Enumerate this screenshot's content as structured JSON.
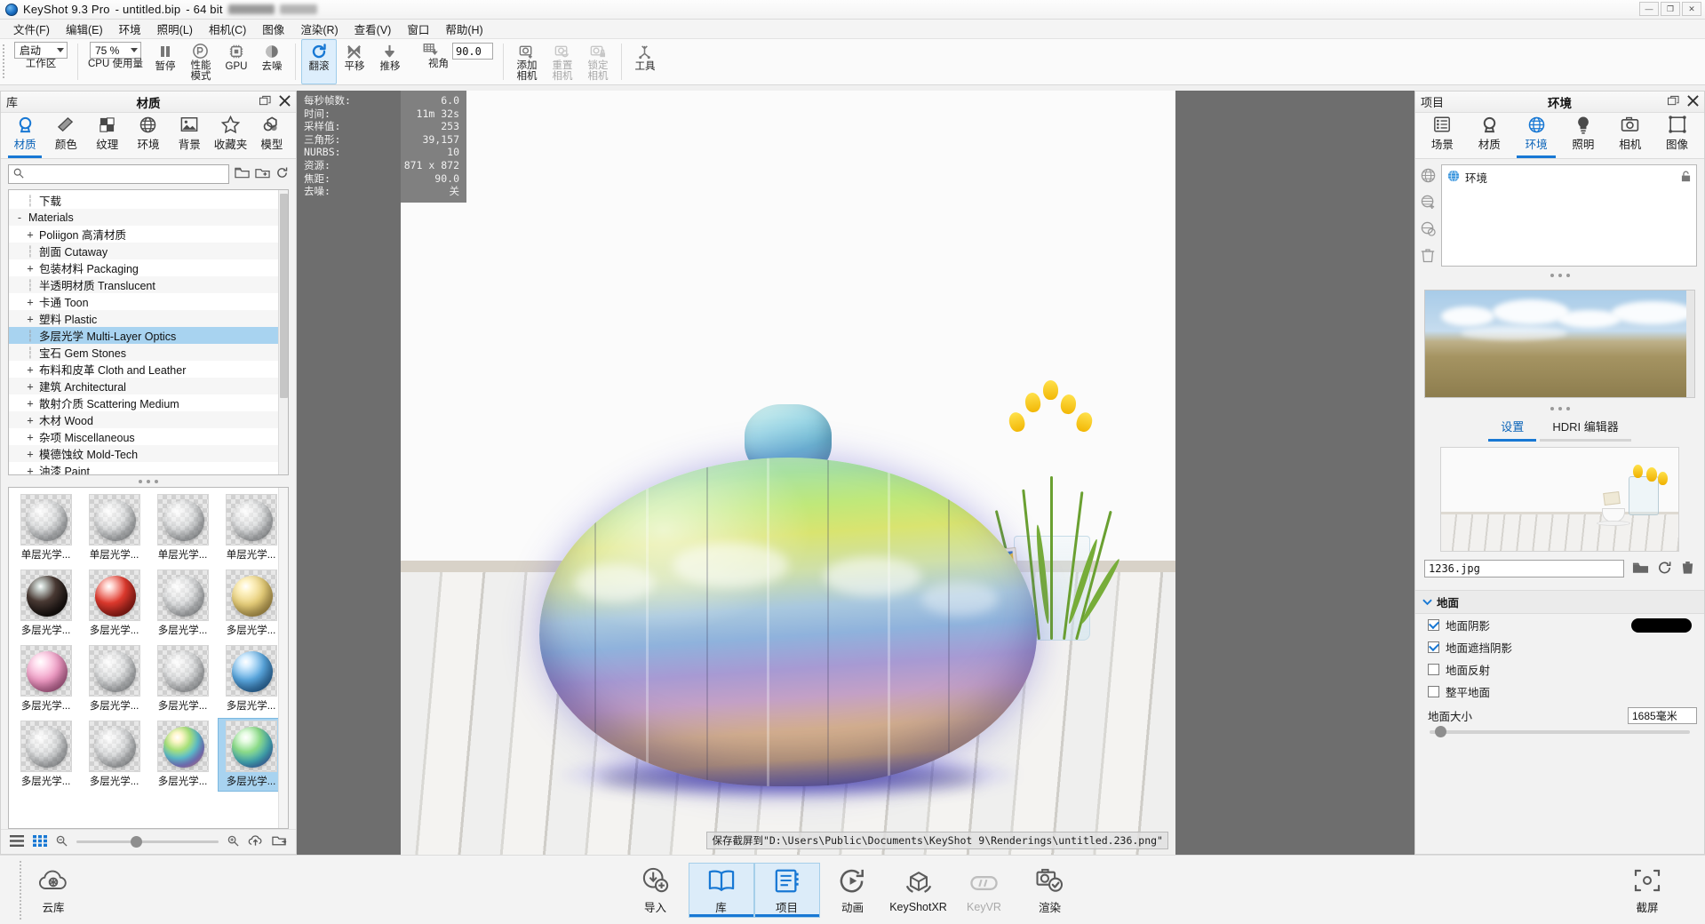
{
  "window": {
    "app_name": "KeyShot 9.3 Pro",
    "document": "- untitled.bip",
    "bits": "- 64 bit",
    "min_label": "—",
    "max_label": "❐",
    "close_label": "✕"
  },
  "menubar": {
    "items": [
      {
        "label": "文件(F)",
        "name": "menu-file"
      },
      {
        "label": "编辑(E)",
        "name": "menu-edit"
      },
      {
        "label": "环境",
        "name": "menu-environment"
      },
      {
        "label": "照明(L)",
        "name": "menu-lighting"
      },
      {
        "label": "相机(C)",
        "name": "menu-camera"
      },
      {
        "label": "图像",
        "name": "menu-image"
      },
      {
        "label": "渲染(R)",
        "name": "menu-render"
      },
      {
        "label": "查看(V)",
        "name": "menu-view"
      },
      {
        "label": "窗口",
        "name": "menu-window"
      },
      {
        "label": "帮助(H)",
        "name": "menu-help"
      }
    ]
  },
  "toolbar": {
    "workspace": {
      "label": "工作区",
      "value": "启动"
    },
    "cpu_usage": {
      "label": "CPU 使用量",
      "value": "75 %"
    },
    "pause": {
      "label": "暂停"
    },
    "performance_mode": {
      "label": "性能\n模式"
    },
    "gpu": {
      "label": "GPU"
    },
    "denoise": {
      "label": "去噪"
    },
    "tumble": {
      "label": "翻滚",
      "active": true
    },
    "pan": {
      "label": "平移"
    },
    "dolly": {
      "label": "推移"
    },
    "fov": {
      "label": "视角",
      "value": "90.0"
    },
    "add_camera": {
      "label": "添加\n相机"
    },
    "reset_camera": {
      "label": "重置\n相机",
      "disabled": true
    },
    "lock_camera": {
      "label": "锁定\n相机",
      "disabled": true
    },
    "tools": {
      "label": "工具"
    }
  },
  "library": {
    "side_title": "库",
    "title": "材质",
    "tabs": [
      {
        "label": "材质",
        "icon": "material-icon",
        "active": true
      },
      {
        "label": "颜色",
        "icon": "color-icon",
        "active": false
      },
      {
        "label": "纹理",
        "icon": "texture-icon",
        "active": false
      },
      {
        "label": "环境",
        "icon": "environment-icon",
        "active": false
      },
      {
        "label": "背景",
        "icon": "backplate-icon",
        "active": false
      },
      {
        "label": "收藏夹",
        "icon": "star-icon",
        "active": false
      },
      {
        "label": "模型",
        "icon": "model-icon",
        "active": false
      }
    ],
    "search": {
      "value": "",
      "placeholder": ""
    },
    "tree": [
      {
        "label": "下载",
        "toggle": "leaf",
        "indent": 1,
        "selected": false
      },
      {
        "label": "Materials",
        "toggle": "-",
        "indent": 0,
        "selected": false
      },
      {
        "label": "Poliigon 高清材质",
        "toggle": "+",
        "indent": 1,
        "selected": false
      },
      {
        "label": "剖面 Cutaway",
        "toggle": "leaf",
        "indent": 1,
        "selected": false
      },
      {
        "label": "包装材料 Packaging",
        "toggle": "+",
        "indent": 1,
        "selected": false
      },
      {
        "label": "半透明材质 Translucent",
        "toggle": "leaf",
        "indent": 1,
        "selected": false
      },
      {
        "label": "卡通 Toon",
        "toggle": "+",
        "indent": 1,
        "selected": false
      },
      {
        "label": "塑料 Plastic",
        "toggle": "+",
        "indent": 1,
        "selected": false
      },
      {
        "label": "多层光学 Multi-Layer Optics",
        "toggle": "leaf",
        "indent": 1,
        "selected": true
      },
      {
        "label": "宝石 Gem Stones",
        "toggle": "leaf",
        "indent": 1,
        "selected": false
      },
      {
        "label": "布料和皮革 Cloth and Leather",
        "toggle": "+",
        "indent": 1,
        "selected": false
      },
      {
        "label": "建筑 Architectural",
        "toggle": "+",
        "indent": 1,
        "selected": false
      },
      {
        "label": "散射介质 Scattering Medium",
        "toggle": "+",
        "indent": 1,
        "selected": false
      },
      {
        "label": "木材 Wood",
        "toggle": "+",
        "indent": 1,
        "selected": false
      },
      {
        "label": "杂项 Miscellaneous",
        "toggle": "+",
        "indent": 1,
        "selected": false
      },
      {
        "label": "模德蚀纹 Mold-Tech",
        "toggle": "+",
        "indent": 1,
        "selected": false
      },
      {
        "label": "油漆 Paint",
        "toggle": "+",
        "indent": 1,
        "selected": false
      }
    ],
    "thumbnails": [
      {
        "label": "单层光学...",
        "tone": "clear",
        "selected": false
      },
      {
        "label": "单层光学...",
        "tone": "clear",
        "selected": false
      },
      {
        "label": "单层光学...",
        "tone": "clear",
        "selected": false
      },
      {
        "label": "单层光学...",
        "tone": "clear",
        "selected": false
      },
      {
        "label": "多层光学...",
        "tone": "dark",
        "selected": false
      },
      {
        "label": "多层光学...",
        "tone": "red",
        "selected": false
      },
      {
        "label": "多层光学...",
        "tone": "clear",
        "selected": false
      },
      {
        "label": "多层光学...",
        "tone": "warm",
        "selected": false
      },
      {
        "label": "多层光学...",
        "tone": "pink",
        "selected": false
      },
      {
        "label": "多层光学...",
        "tone": "clear",
        "selected": false
      },
      {
        "label": "多层光学...",
        "tone": "clear",
        "selected": false
      },
      {
        "label": "多层光学...",
        "tone": "blue",
        "selected": false
      },
      {
        "label": "多层光学...",
        "tone": "clear",
        "selected": false
      },
      {
        "label": "多层光学...",
        "tone": "clear",
        "selected": false
      },
      {
        "label": "多层光学...",
        "tone": "rainbow",
        "selected": false
      },
      {
        "label": "多层光学...",
        "tone": "green",
        "selected": true
      }
    ],
    "footer": {
      "list_view": "list-view-icon",
      "grid_view": "grid-view-icon",
      "zoom_out": "zoom-out-icon",
      "zoom_in": "zoom-in-icon",
      "upload": "cloud-upload-icon",
      "open_folder": "open-folder-icon"
    }
  },
  "viewport": {
    "hud": [
      {
        "key": "每秒帧数:",
        "value": "6.0"
      },
      {
        "key": "时间:",
        "value": "11m 32s"
      },
      {
        "key": "采样值:",
        "value": "253"
      },
      {
        "key": "三角形:",
        "value": "39,157"
      },
      {
        "key": "NURBS:",
        "value": "10"
      },
      {
        "key": "资源:",
        "value": "871 x 872"
      },
      {
        "key": "焦距:",
        "value": "90.0"
      },
      {
        "key": "去噪:",
        "value": "关"
      }
    ],
    "status_message": "保存截屏到\"D:\\Users\\Public\\Documents\\KeyShot 9\\Renderings\\untitled.236.png\""
  },
  "project": {
    "side_title": "项目",
    "title": "环境",
    "tabs": [
      {
        "label": "场景",
        "icon": "scene-icon",
        "active": false
      },
      {
        "label": "材质",
        "icon": "material-icon",
        "active": false
      },
      {
        "label": "环境",
        "icon": "environment-icon",
        "active": true
      },
      {
        "label": "照明",
        "icon": "lighting-icon",
        "active": false
      },
      {
        "label": "相机",
        "icon": "camera-icon",
        "active": false
      },
      {
        "label": "图像",
        "icon": "image-icon",
        "active": false
      }
    ],
    "env_item": {
      "label": "环境",
      "lock": "lock-icon"
    },
    "sub_tabs": [
      {
        "label": "设置",
        "active": true
      },
      {
        "label": "HDRI 编辑器",
        "active": false
      }
    ],
    "hdri_file": "1236.jpg",
    "file_actions": [
      "open-folder-icon",
      "refresh-icon",
      "delete-icon"
    ],
    "ground": {
      "section_label": "地面",
      "options": [
        {
          "label": "地面阴影",
          "checked": true,
          "has_swatch": true,
          "swatch_color": "#000000"
        },
        {
          "label": "地面遮挡阴影",
          "checked": true,
          "has_swatch": false
        },
        {
          "label": "地面反射",
          "checked": false,
          "has_swatch": false
        },
        {
          "label": "整平地面",
          "checked": false,
          "has_swatch": false
        }
      ],
      "size_label": "地面大小",
      "size_value": "1685毫米"
    }
  },
  "dock": {
    "cloud": {
      "label": "云库",
      "icon": "cloud-library-icon"
    },
    "items": [
      {
        "label": "导入",
        "icon": "import-icon",
        "active": false,
        "dim": false
      },
      {
        "label": "库",
        "icon": "library-icon",
        "active": true,
        "dim": false
      },
      {
        "label": "项目",
        "icon": "project-icon",
        "active": true,
        "dim": false
      },
      {
        "label": "动画",
        "icon": "animation-icon",
        "active": false,
        "dim": false
      },
      {
        "label": "KeyShotXR",
        "icon": "keyshotxr-icon",
        "active": false,
        "dim": false
      },
      {
        "label": "KeyVR",
        "icon": "keyvr-icon",
        "active": false,
        "dim": true
      },
      {
        "label": "渲染",
        "icon": "render-icon",
        "active": false,
        "dim": false
      }
    ],
    "screenshot": {
      "label": "截屏",
      "icon": "screenshot-icon"
    }
  },
  "colors": {
    "accent": "#1878d4",
    "selection": "#a8d3f0",
    "panel_bg": "#f2f2f2",
    "viewport_bg": "#6e6e6e"
  }
}
